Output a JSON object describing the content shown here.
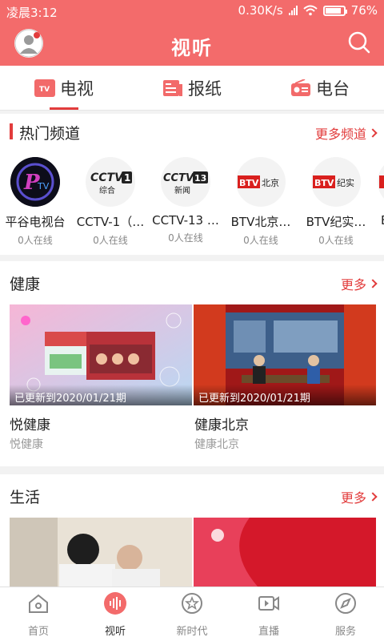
{
  "status_bar": {
    "time": "凌晨3:12",
    "speed": "0.30K/s",
    "battery": "76%"
  },
  "header": {
    "title": "视听"
  },
  "tabs": [
    {
      "label": "电视",
      "icon": "tv-icon",
      "active": true
    },
    {
      "label": "报纸",
      "icon": "newspaper-icon",
      "active": false
    },
    {
      "label": "电台",
      "icon": "radio-icon",
      "active": false
    }
  ],
  "hot": {
    "title": "热门频道",
    "more": "更多频道",
    "channels": [
      {
        "name": "平谷电视台",
        "online": "0人在线",
        "logo": "PTV"
      },
      {
        "name": "CCTV-1（…",
        "online": "0人在线",
        "logo": "CCTV1 综合"
      },
      {
        "name": "CCTV-13 …",
        "online": "0人在线",
        "logo": "CCTV13 新闻"
      },
      {
        "name": "BTV北京…",
        "online": "0人在线",
        "logo": "BTV 北京"
      },
      {
        "name": "BTV纪实…",
        "online": "0人在线",
        "logo": "BTV 纪实"
      },
      {
        "name": "B",
        "online": "",
        "logo": ""
      }
    ]
  },
  "health": {
    "title": "健康",
    "more": "更多",
    "items": [
      {
        "caption": "已更新到2020/01/21期",
        "title": "悦健康",
        "sub": "悦健康"
      },
      {
        "caption": "已更新到2020/01/21期",
        "title": "健康北京",
        "sub": "健康北京"
      }
    ]
  },
  "life": {
    "title": "生活",
    "more": "更多"
  },
  "bottom_nav": [
    {
      "label": "首页",
      "icon": "home-icon",
      "active": false
    },
    {
      "label": "视听",
      "icon": "audio-wave-icon",
      "active": true
    },
    {
      "label": "新时代",
      "icon": "star-badge-icon",
      "active": false
    },
    {
      "label": "直播",
      "icon": "video-camera-icon",
      "active": false
    },
    {
      "label": "服务",
      "icon": "compass-icon",
      "active": false
    }
  ],
  "colors": {
    "accent": "#f36b6b",
    "red": "#e23c3c"
  }
}
